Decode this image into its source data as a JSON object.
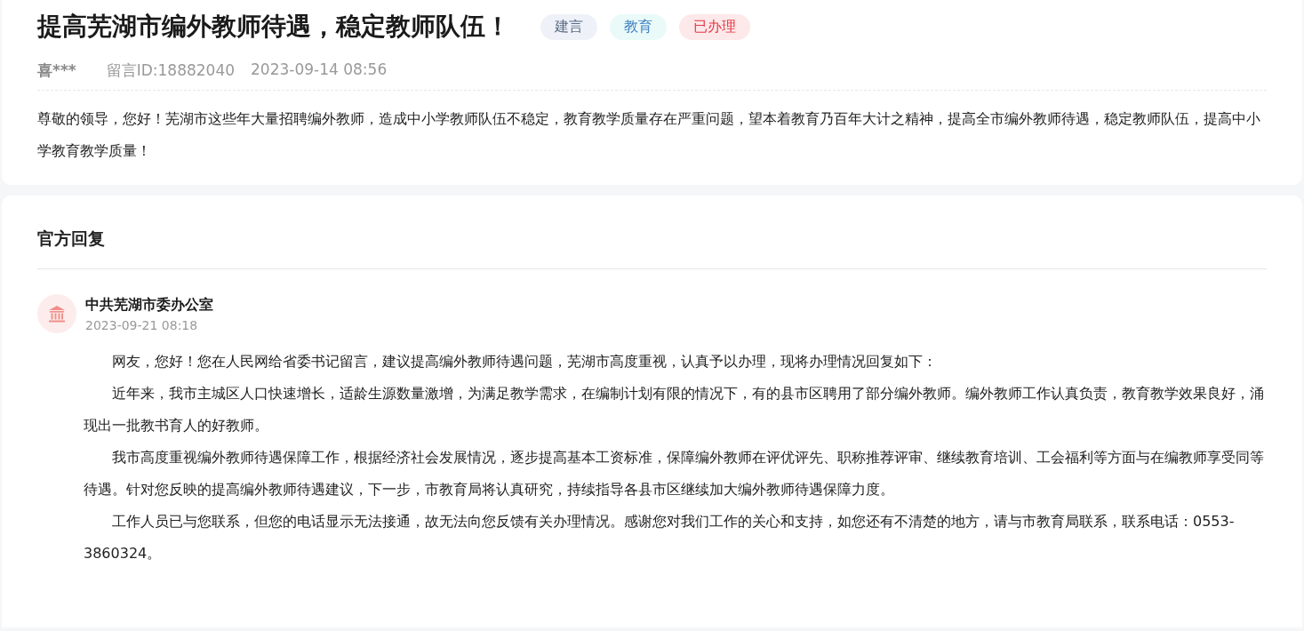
{
  "message": {
    "title": "提高芜湖市编外教师待遇，稳定教师队伍！",
    "tags": [
      {
        "label": "建言",
        "kind": "type"
      },
      {
        "label": "教育",
        "kind": "field"
      },
      {
        "label": "已办理",
        "kind": "status"
      }
    ],
    "author": "喜***",
    "message_id": "留言ID:18882040",
    "date": "2023-09-14 08:56",
    "body": "尊敬的领导，您好！芜湖市这些年大量招聘编外教师，造成中小学教师队伍不稳定，教育教学质量存在严重问题，望本着教育乃百年大计之精神，提高全市编外教师待遇，稳定教师队伍，提高中小学教育教学质量！"
  },
  "reply": {
    "heading": "官方回复",
    "office": "中共芜湖市委办公室",
    "date": "2023-09-21 08:18",
    "paragraphs": [
      "网友，您好！您在人民网给省委书记留言，建议提高编外教师待遇问题，芜湖市高度重视，认真予以办理，现将办理情况回复如下：",
      "近年来，我市主城区人口快速增长，适龄生源数量激增，为满足教学需求，在编制计划有限的情况下，有的县市区聘用了部分编外教师。编外教师工作认真负责，教育教学效果良好，涌现出一批教书育人的好教师。",
      "我市高度重视编外教师待遇保障工作，根据经济社会发展情况，逐步提高基本工资标准，保障编外教师在评优评先、职称推荐评审、继续教育培训、工会福利等方面与在编教师享受同等待遇。针对您反映的提高编外教师待遇建议，下一步，市教育局将认真研究，持续指导各县市区继续加大编外教师待遇保障力度。",
      "工作人员已与您联系，但您的电话显示无法接通，故无法向您反馈有关办理情况。感谢您对我们工作的关心和支持，如您还有不清楚的地方，请与市教育局联系，联系电话：0553-3860324。"
    ]
  }
}
